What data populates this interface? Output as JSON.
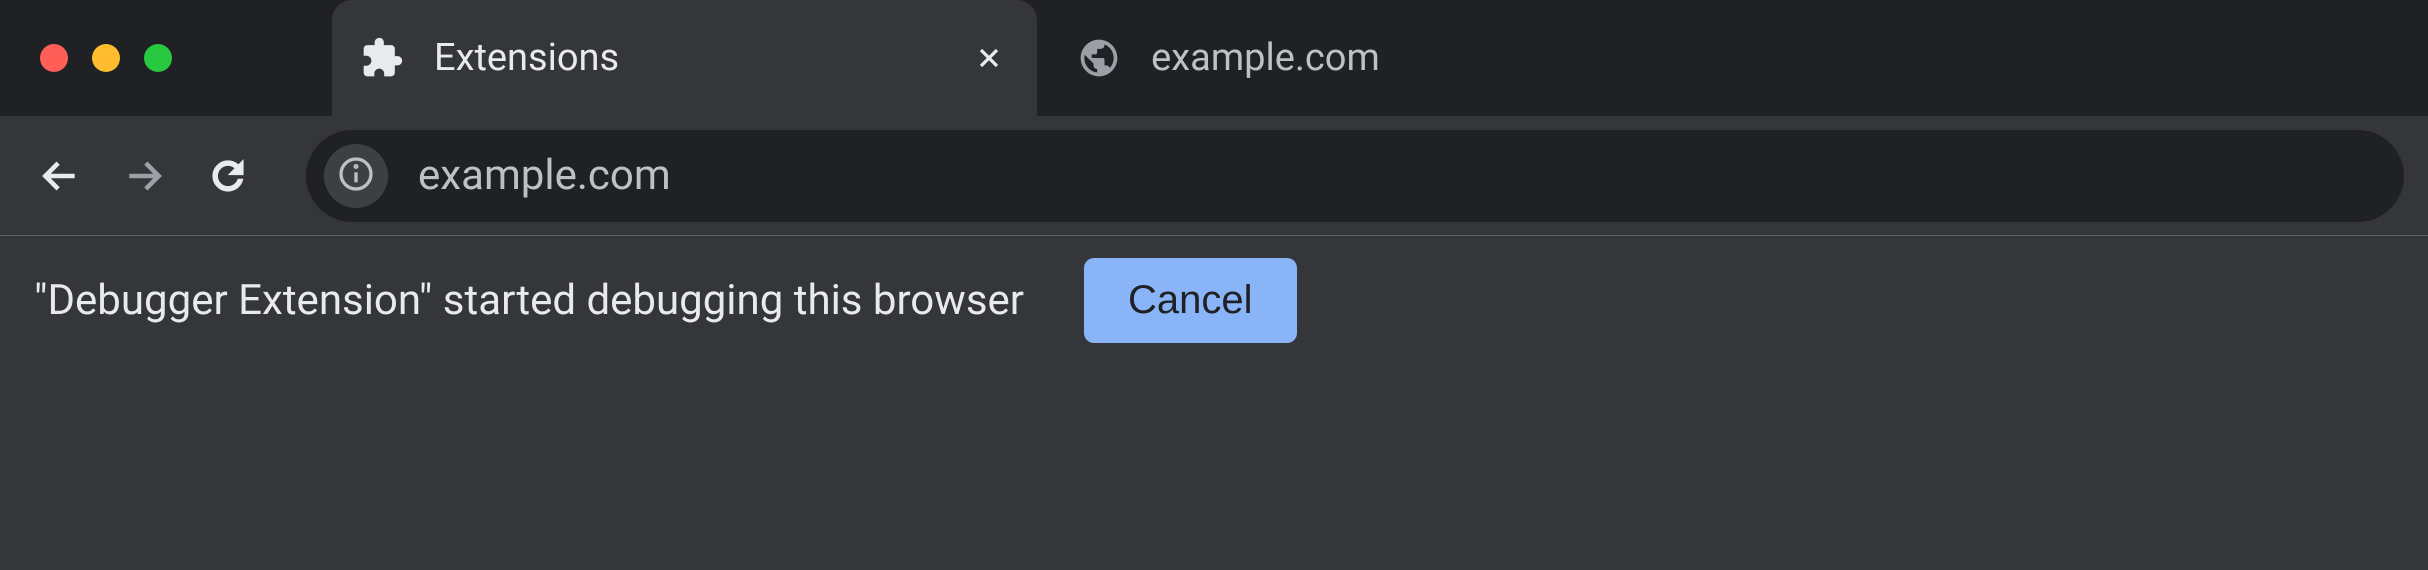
{
  "window": {
    "traffic_lights": [
      "close",
      "minimize",
      "maximize"
    ]
  },
  "tabs": [
    {
      "title": "Extensions",
      "icon": "puzzle-piece-icon",
      "active": true,
      "closable": true
    },
    {
      "title": "example.com",
      "icon": "globe-icon",
      "active": false,
      "closable": false
    }
  ],
  "toolbar": {
    "back_enabled": true,
    "forward_enabled": false,
    "url": "example.com",
    "site_info_icon": "info-icon"
  },
  "infobar": {
    "message": "\"Debugger Extension\" started debugging this browser",
    "cancel_label": "Cancel"
  }
}
